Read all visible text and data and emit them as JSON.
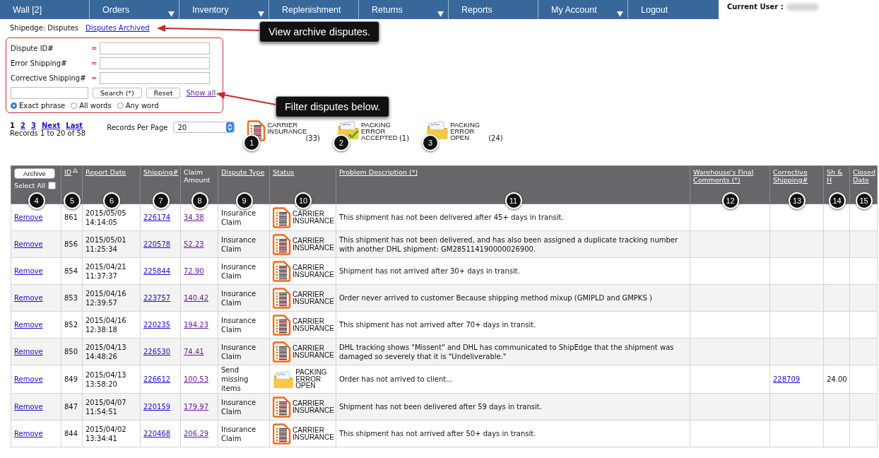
{
  "nav": {
    "items": [
      {
        "label": "Wall [2]",
        "dropdown": false
      },
      {
        "label": "Orders",
        "dropdown": true
      },
      {
        "label": "Inventory",
        "dropdown": true
      },
      {
        "label": "Replenishment",
        "dropdown": false
      },
      {
        "label": "Returns",
        "dropdown": true
      },
      {
        "label": "Reports",
        "dropdown": false
      },
      {
        "label": "My Account",
        "dropdown": true
      },
      {
        "label": "Logout",
        "dropdown": false
      }
    ],
    "current_user_label": "Current User :"
  },
  "breadcrumb": {
    "text": "Shipedge: Disputes",
    "link": "Disputes Archived"
  },
  "callouts": [
    "View archive disputes.",
    "Filter disputes below."
  ],
  "filter": {
    "fields": [
      {
        "label": "Dispute ID#",
        "operator": "="
      },
      {
        "label": "Error Shipping#",
        "operator": "="
      },
      {
        "label": "Corrective Shipping#",
        "operator": "="
      }
    ],
    "search_button": "Search (*)",
    "reset_button": "Reset",
    "show_all": "Show all",
    "match_options": [
      {
        "label": "Exact phrase",
        "selected": true
      },
      {
        "label": "All words",
        "selected": false
      },
      {
        "label": "Any word",
        "selected": false
      }
    ]
  },
  "pagination": {
    "pages": [
      {
        "label": "1",
        "selected": true
      },
      {
        "label": "2",
        "selected": false
      },
      {
        "label": "3",
        "selected": false
      }
    ],
    "next": "Next",
    "last": "Last",
    "summary": "Records 1 to 20 of 58"
  },
  "records_per_page": {
    "label": "Records Per Page",
    "value": "20"
  },
  "legend": [
    {
      "kind": "carrier_insurance",
      "label": "CARRIER INSURANCE",
      "count": "(33)",
      "marker": "1"
    },
    {
      "kind": "packing_error_accepted",
      "label": "PACKING ERROR ACCEPTED",
      "count": "(1)",
      "marker": "2"
    },
    {
      "kind": "packing_error_open",
      "label": "PACKING ERROR OPEN",
      "count": "(24)",
      "marker": "3"
    }
  ],
  "table": {
    "selection_column": {
      "button": "Archive",
      "select_all": "Select All",
      "checked": false,
      "marker": "4"
    },
    "columns": [
      {
        "label": "ID",
        "link": true,
        "sorted": true,
        "marker": "5"
      },
      {
        "label": "Report Date",
        "link": true,
        "sorted": false,
        "marker": "6"
      },
      {
        "label": "Shipping#",
        "link": true,
        "sorted": false,
        "marker": "7"
      },
      {
        "label": "Claim Amount",
        "link": false,
        "sorted": false,
        "marker": "8"
      },
      {
        "label": "Dispute Type",
        "link": true,
        "sorted": false,
        "marker": "9"
      },
      {
        "label": "Status",
        "link": true,
        "sorted": false,
        "marker": "10"
      },
      {
        "label": "Problem Description (*)",
        "link": true,
        "sorted": false,
        "marker": "11"
      },
      {
        "label": "Warehouse's Final Comments (*)",
        "link": true,
        "sorted": false,
        "marker": "12"
      },
      {
        "label": "Corrective Shipping#",
        "link": true,
        "sorted": false,
        "marker": "13"
      },
      {
        "label": "Sh & H",
        "link": true,
        "sorted": false,
        "marker": "14"
      },
      {
        "label": "Closed Date",
        "link": true,
        "sorted": false,
        "marker": "15"
      }
    ],
    "rows": [
      {
        "action": "Remove",
        "id": "861",
        "report_date": "2015/05/05 14:14:05",
        "shipping": "226174",
        "claim_amount": "34.38",
        "dispute_type": "Insurance Claim",
        "status": {
          "kind": "carrier_insurance",
          "label": "CARRIER INSURANCE"
        },
        "problem": "This shipment has not been delivered after 45+ days in transit."
      },
      {
        "action": "Remove",
        "id": "856",
        "report_date": "2015/05/01 11:25:34",
        "shipping": "220578",
        "claim_amount": "52.23",
        "dispute_type": "Insurance Claim",
        "status": {
          "kind": "carrier_insurance",
          "label": "CARRIER INSURANCE"
        },
        "problem": "This shipment has not been delivered, and has also been assigned a duplicate tracking number with another DHL shipment: GM285114190000026900."
      },
      {
        "action": "Remove",
        "id": "854",
        "report_date": "2015/04/21 11:37:37",
        "shipping": "225844",
        "claim_amount": "72.90",
        "dispute_type": "Insurance Claim",
        "status": {
          "kind": "carrier_insurance",
          "label": "CARRIER INSURANCE"
        },
        "problem": "Shipment has not arrived after 30+ days in transit."
      },
      {
        "action": "Remove",
        "id": "853",
        "report_date": "2015/04/16 12:39:57",
        "shipping": "223757",
        "claim_amount": "140.42",
        "dispute_type": "Insurance Claim",
        "status": {
          "kind": "carrier_insurance",
          "label": "CARRIER INSURANCE"
        },
        "problem": "Order never arrived to customer Because shipping method mixup (GMIPLD and GMPKS )"
      },
      {
        "action": "Remove",
        "id": "852",
        "report_date": "2015/04/16 12:38:18",
        "shipping": "220235",
        "claim_amount": "194.23",
        "dispute_type": "Insurance Claim",
        "status": {
          "kind": "carrier_insurance",
          "label": "CARRIER INSURANCE"
        },
        "problem": "This shipment has not arrived after 70+ days in transit."
      },
      {
        "action": "Remove",
        "id": "850",
        "report_date": "2015/04/13 14:48:26",
        "shipping": "226530",
        "claim_amount": "74.41",
        "dispute_type": "Insurance Claim",
        "status": {
          "kind": "carrier_insurance",
          "label": "CARRIER INSURANCE"
        },
        "problem": "DHL tracking shows \"Missent\" and DHL has communicated to ShipEdge that the shipment was damaged so severely that it is \"Undeliverable.\""
      },
      {
        "action": "Remove",
        "id": "849",
        "report_date": "2015/04/13 13:58:20",
        "shipping": "226612",
        "claim_amount": "100.53",
        "dispute_type": "Send missing items",
        "status": {
          "kind": "packing_error_open",
          "label": "PACKING ERROR OPEN"
        },
        "problem": "Order has not arrived to client...",
        "corrective_shipping": "228709",
        "sh_h": "24.00"
      },
      {
        "action": "Remove",
        "id": "847",
        "report_date": "2015/04/07 11:54:51",
        "shipping": "220159",
        "claim_amount": "179.97",
        "dispute_type": "Insurance Claim",
        "status": {
          "kind": "carrier_insurance",
          "label": "CARRIER INSURANCE"
        },
        "problem": "Shipment has not been delivered after 59 days in transit."
      },
      {
        "action": "Remove",
        "id": "844",
        "report_date": "2015/04/02 13:34:41",
        "shipping": "220468",
        "claim_amount": "206.29",
        "dispute_type": "Insurance Claim",
        "status": {
          "kind": "carrier_insurance",
          "label": "CARRIER INSURANCE"
        },
        "problem": "This shipment has not arrived after 50+ days in transit."
      }
    ]
  }
}
